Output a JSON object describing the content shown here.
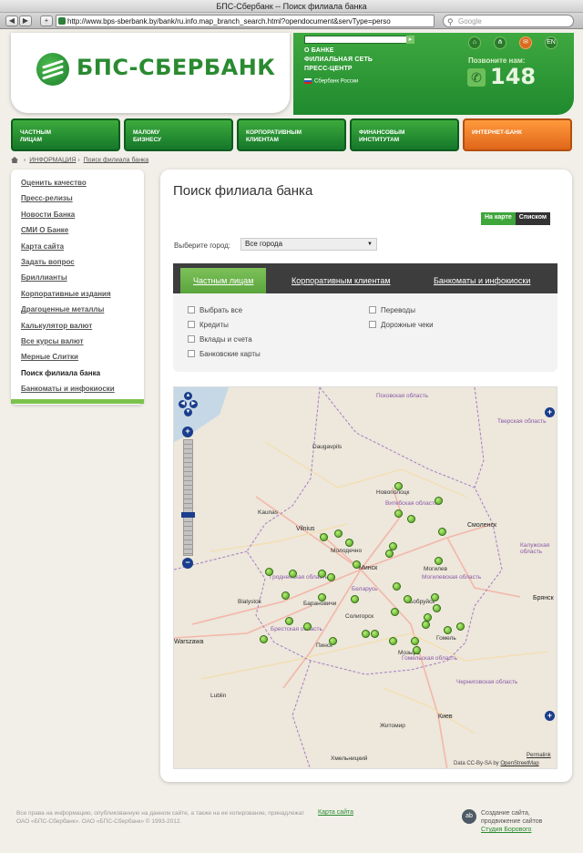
{
  "browser": {
    "window_title": "БПС-Сбербанк -- Поиск филиала банка",
    "url": "http://www.bps-sberbank.by/bank/ru.info.map_branch_search.html?opendocument&servType=perso",
    "search_placeholder": "Google"
  },
  "header": {
    "logo_text": "БПС-СБЕРБАНК",
    "links": [
      "О БАНКЕ",
      "ФИЛИАЛЬНАЯ СЕТЬ",
      "ПРЕСС-ЦЕНТР"
    ],
    "russia_link": "Сбербанк России",
    "lang": "EN",
    "call_label": "Позвоните нам:",
    "call_number": "148"
  },
  "main_nav": [
    {
      "line1": "ЧАСТНЫМ",
      "line2": "ЛИЦАМ"
    },
    {
      "line1": "МАЛОМУ",
      "line2": "БИЗНЕСУ"
    },
    {
      "line1": "КОРПОРАТИВНЫМ",
      "line2": "КЛИЕНТАМ"
    },
    {
      "line1": "ФИНАНСОВЫМ",
      "line2": "ИНСТИТУТАМ"
    },
    {
      "line1": "ИНТЕРНЕТ-БАНК",
      "line2": ""
    }
  ],
  "breadcrumb": [
    "ИНФОРМАЦИЯ",
    "Поиск филиала банка"
  ],
  "sidebar": {
    "items": [
      "Оценить качество",
      "Пресс-релизы",
      "Новости Банка",
      "СМИ О Банке",
      "Карта сайта",
      "Задать вопрос",
      "Бриллианты",
      "Корпоративные издания",
      "Драгоценные металлы",
      "Калькулятор валют",
      "Все курсы валют",
      "Мерные Слитки",
      "Поиск филиала банка",
      "Банкоматы и инфокиоски"
    ],
    "active_index": 12
  },
  "content": {
    "title": "Поиск филиала банка",
    "view_map": "На карте",
    "view_list": "Списком",
    "city_label": "Выберите город:",
    "city_value": "Все города",
    "tabs": [
      "Частным лицам",
      "Корпоративным клиентам",
      "Банкоматы и инфокиоски"
    ],
    "filters_left": [
      "Выбрать все",
      "Кредиты",
      "Вклады и счета",
      "Банковские карты"
    ],
    "filters_right": [
      "Переводы",
      "Дорожные чеки"
    ]
  },
  "map": {
    "labels_big": [
      "Vilnius",
      "Минск",
      "Смоленск",
      "Брянск",
      "Warszawa",
      "Киев",
      "Беларусь"
    ],
    "labels_small": [
      "Псковская область",
      "Тверская область",
      "Новополоцк",
      "Витебская область",
      "Молодечно",
      "Гродненская область",
      "Могилев",
      "Могилевская область",
      "Bialystok",
      "Барановичи",
      "Бобруйск",
      "Солигорск",
      "Брестская область",
      "Пинск",
      "Гомель",
      "Мозырь",
      "Гомельская область",
      "Калужская область",
      "Житомир",
      "Черниговская область",
      "Хмельницкий",
      "Lublin",
      "Kaunas",
      "Daugavpils"
    ],
    "permalink": "Permalink",
    "attribution_prefix": "Data CC-By-SA by",
    "attribution_link": "OpenStreetMap"
  },
  "footer": {
    "copyright": "Все права на информацию, опубликованную на данном сайте, а также на ее копирование, принадлежат ОАО «БПС-Сбербанк». ОАО «БПС-Сбербанк» © 1993-2012.",
    "sitemap_link": "Карта сайта",
    "studio_line1": "Создание сайта,",
    "studio_line2": "продвижение сайтов",
    "studio_link": "Студия Борового"
  },
  "colors": {
    "brand_green": "#2a8a30",
    "orange": "#e0661a",
    "pin_green": "#4c9c1a"
  }
}
